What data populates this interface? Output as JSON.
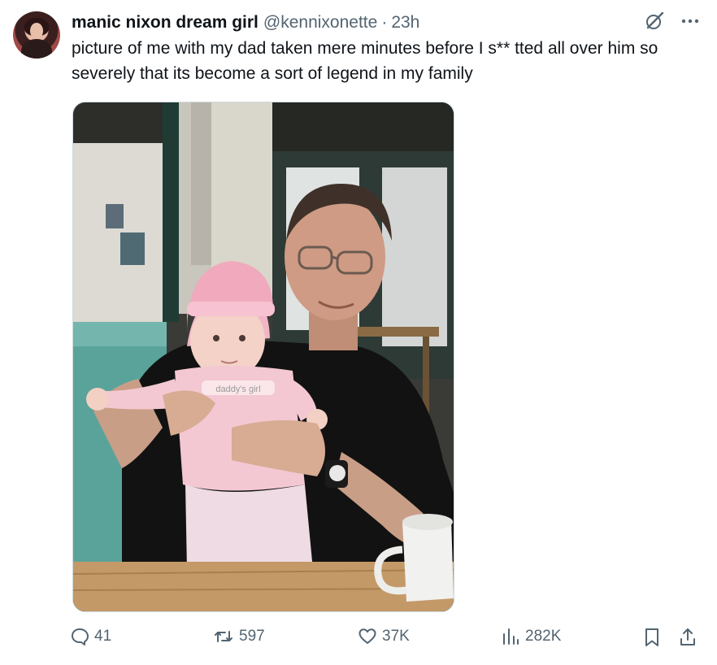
{
  "post": {
    "display_name": "manic nixon dream girl",
    "handle": "@kennixonette",
    "separator": "·",
    "time": "23h",
    "text": "picture of me with my dad taken mere minutes before I s** tted all over him so severely that its become a sort of legend in my family",
    "image_text": "daddy's girl"
  },
  "actions": {
    "replies": "41",
    "reposts": "597",
    "likes": "37K",
    "views": "282K"
  },
  "icons": {
    "grok": "grok-icon",
    "more": "more-icon",
    "reply": "reply-icon",
    "repost": "repost-icon",
    "like": "heart-icon",
    "views": "views-icon",
    "bookmark": "bookmark-icon",
    "share": "share-icon"
  },
  "colors": {
    "text": "#0f1419",
    "secondary": "#536471",
    "border": "#cfd9de"
  }
}
